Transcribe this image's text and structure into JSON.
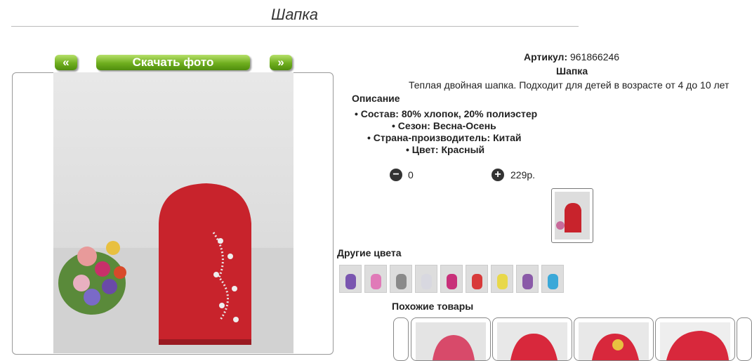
{
  "header": {
    "title": "Шапка"
  },
  "gallery": {
    "prev_label": "«",
    "download_label": "Скачать фото",
    "next_label": "»"
  },
  "product": {
    "article_label": "Артикул:",
    "article_value": "961866246",
    "name": "Шапка",
    "description": "Теплая двойная шапка. Подходит для детей в возрасте от 4 до 10 лет",
    "description_heading": "Описание",
    "features": [
      "• Состав: 80% хлопок, 20% полиэстер",
      "• Сезон: Весна-Осень",
      "• Страна-производитель: Китай",
      "• Цвет: Красный"
    ],
    "quantity": "0",
    "price": "229р."
  },
  "other_colors": {
    "heading": "Другие цвета",
    "swatches": [
      "#7a56b0",
      "#e07ab8",
      "#8a8a8a",
      "#d8d8e0",
      "#c8307a",
      "#d83a3a",
      "#e8d84a",
      "#8a5aa8",
      "#3aa8d8"
    ]
  },
  "similar": {
    "heading": "Похожие товары"
  },
  "colors": {
    "accent_green": "#6fae1e",
    "hat_red": "#c8232c"
  }
}
